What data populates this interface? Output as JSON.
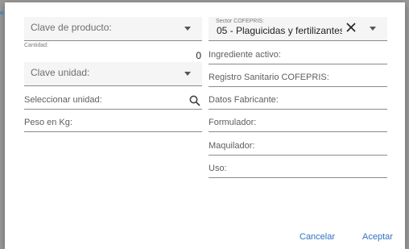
{
  "form": {
    "clave_producto": {
      "label": "Clave de producto:"
    },
    "cantidad": {
      "label": "Cantidad:",
      "value": "0"
    },
    "clave_unidad": {
      "label": "Clave unidad:"
    },
    "seleccionar_unidad": {
      "label": "Seleccionar unidad:"
    },
    "peso": {
      "label": "Peso en Kg:"
    },
    "sector": {
      "label": "Sector COFEPRIS:",
      "value": "05 - Plaguicidas y fertilizantes"
    },
    "ingrediente": {
      "label": "Ingrediente activo:"
    },
    "registro": {
      "label": "Registro Sanitario COFEPRIS:"
    },
    "fabricante": {
      "label": "Datos Fabricante:"
    },
    "formulador": {
      "label": "Formulador:"
    },
    "maquilador": {
      "label": "Maquilador:"
    },
    "uso": {
      "label": "Uso:"
    }
  },
  "actions": {
    "cancel_label": "Cancelar",
    "accept_label": "Aceptar"
  },
  "icons": {
    "clear": "close-icon",
    "search": "search-icon",
    "dropdown": "chevron-down-icon"
  }
}
